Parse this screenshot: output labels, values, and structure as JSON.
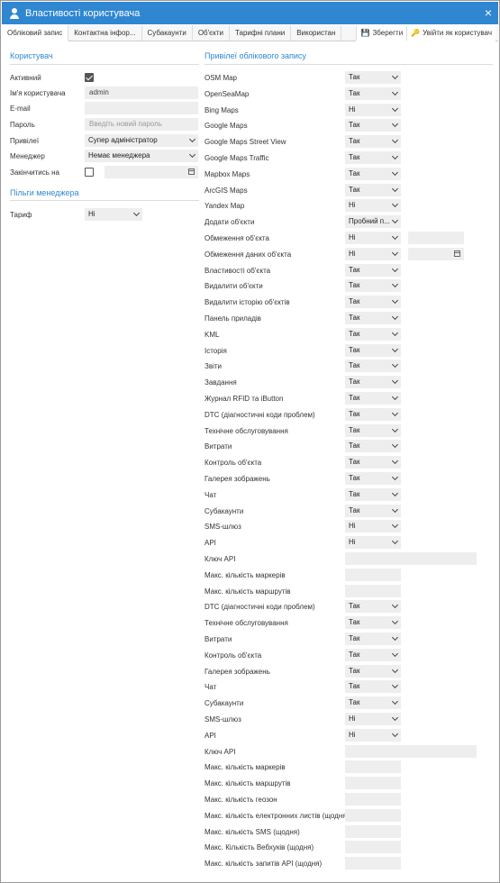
{
  "window": {
    "title": "Властивості користувача",
    "close": "×"
  },
  "tabs": [
    {
      "label": "Обліковий запис",
      "active": true
    },
    {
      "label": "Контактна інфор..."
    },
    {
      "label": "Субакаунти"
    },
    {
      "label": "Об'єкти"
    },
    {
      "label": "Тарифні плани"
    },
    {
      "label": "Використан"
    }
  ],
  "actions": {
    "save": "Зберегти",
    "login_as": "Увійти як користувач"
  },
  "user_section": {
    "title": "Користувач",
    "active_label": "Активний",
    "active_checked": true,
    "username_label": "Ім'я користувача",
    "username_value": "admin",
    "email_label": "E-mail",
    "email_value": "",
    "password_label": "Пароль",
    "password_placeholder": "Введіть новий пароль",
    "privileges_label": "Привілеї",
    "privileges_value": "Супер адміністратор",
    "manager_label": "Менеджер",
    "manager_value": "Немає менеджера",
    "expires_label": "Закінчитись на",
    "expires_checked": false
  },
  "manager_benefits": {
    "title": "Пільги менеджера",
    "tariff_label": "Тариф",
    "tariff_value": "Ні"
  },
  "account_privileges": {
    "title": "Привілеї облікового запису",
    "rows": [
      {
        "label": "OSM Map",
        "type": "select",
        "value": "Так"
      },
      {
        "label": "OpenSeaMap",
        "type": "select",
        "value": "Так"
      },
      {
        "label": "Bing Maps",
        "type": "select",
        "value": "Ні"
      },
      {
        "label": "Google Maps",
        "type": "select",
        "value": "Так"
      },
      {
        "label": "Google Maps Street View",
        "type": "select",
        "value": "Так"
      },
      {
        "label": "Google Maps Traffic",
        "type": "select",
        "value": "Так"
      },
      {
        "label": "Mapbox Maps",
        "type": "select",
        "value": "Так"
      },
      {
        "label": "ArcGIS Maps",
        "type": "select",
        "value": "Так"
      },
      {
        "label": "Yandex Map",
        "type": "select",
        "value": "Ні"
      },
      {
        "label": "Додати об'єкти",
        "type": "select",
        "value": "Пробний п..."
      },
      {
        "label": "Обмеження об'єкта",
        "type": "select",
        "value": "Ні",
        "extra": "input"
      },
      {
        "label": "Обмеження даних об'єкта",
        "type": "select",
        "value": "Ні",
        "extra": "date"
      },
      {
        "label": "Властивості об'єкта",
        "type": "select",
        "value": "Так"
      },
      {
        "label": "Видалити об'єкти",
        "type": "select",
        "value": "Так"
      },
      {
        "label": "Видалити історію об'єктів",
        "type": "select",
        "value": "Так"
      },
      {
        "label": "Панель приладів",
        "type": "select",
        "value": "Так"
      },
      {
        "label": "KML",
        "type": "select",
        "value": "Так"
      },
      {
        "label": "Історія",
        "type": "select",
        "value": "Так"
      },
      {
        "label": "Звіти",
        "type": "select",
        "value": "Так"
      },
      {
        "label": "Завдання",
        "type": "select",
        "value": "Так"
      },
      {
        "label": "Журнал RFID та iButton",
        "type": "select",
        "value": "Так"
      },
      {
        "label": "DTC (діагностичні коди проблем)",
        "type": "select",
        "value": "Так"
      },
      {
        "label": "Технічне обслуговування",
        "type": "select",
        "value": "Так"
      },
      {
        "label": "Витрати",
        "type": "select",
        "value": "Так"
      },
      {
        "label": "Контроль об'єкта",
        "type": "select",
        "value": "Так"
      },
      {
        "label": "Галерея зображень",
        "type": "select",
        "value": "Так"
      },
      {
        "label": "Чат",
        "type": "select",
        "value": "Так"
      },
      {
        "label": "Субакаунти",
        "type": "select",
        "value": "Так"
      },
      {
        "label": "SMS-шлюз",
        "type": "select",
        "value": "Ні"
      },
      {
        "label": "API",
        "type": "select",
        "value": "Ні"
      },
      {
        "label": "Ключ API",
        "type": "wide-input",
        "value": ""
      },
      {
        "label": "Макс. кількість маркерів",
        "type": "input",
        "value": ""
      },
      {
        "label": "Макс. кількість маршрутів",
        "type": "input",
        "value": ""
      },
      {
        "label": "DTC (діагностичні коди проблем)",
        "type": "select",
        "value": "Так"
      },
      {
        "label": "Технічне обслуговування",
        "type": "select",
        "value": "Так"
      },
      {
        "label": "Витрати",
        "type": "select",
        "value": "Так"
      },
      {
        "label": "Контроль об'єкта",
        "type": "select",
        "value": "Так"
      },
      {
        "label": "Галерея зображень",
        "type": "select",
        "value": "Так"
      },
      {
        "label": "Чат",
        "type": "select",
        "value": "Так"
      },
      {
        "label": "Субакаунти",
        "type": "select",
        "value": "Так"
      },
      {
        "label": "SMS-шлюз",
        "type": "select",
        "value": "Ні"
      },
      {
        "label": "API",
        "type": "select",
        "value": "Ні"
      },
      {
        "label": "Ключ API",
        "type": "wide-input",
        "value": ""
      },
      {
        "label": "Макс. кількість маркерів",
        "type": "input",
        "value": ""
      },
      {
        "label": "Макс. кількість маршрутів",
        "type": "input",
        "value": ""
      },
      {
        "label": "Макс. кількість геозон",
        "type": "input",
        "value": ""
      },
      {
        "label": "Макс. кількість електронних листів (щодня)",
        "type": "input",
        "value": ""
      },
      {
        "label": "Макс. кількість SMS (щодня)",
        "type": "input",
        "value": ""
      },
      {
        "label": "Макс. Кількість Вебхуків (щодня)",
        "type": "input",
        "value": ""
      },
      {
        "label": "Макс. кількість запитів API (щодня)",
        "type": "input",
        "value": ""
      }
    ]
  }
}
